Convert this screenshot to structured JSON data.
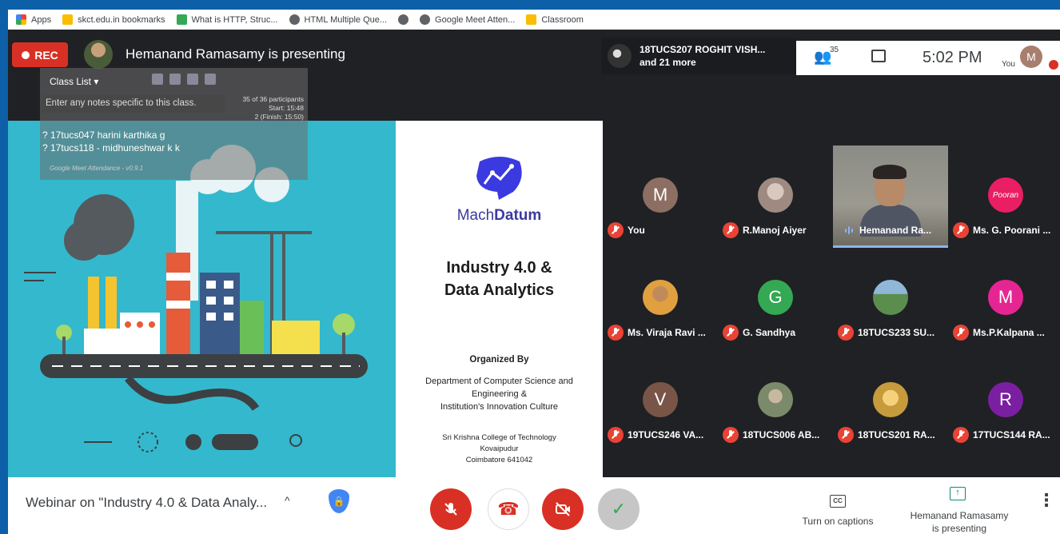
{
  "bookmarks": [
    {
      "label": "Apps",
      "icon": "apps-grid-icon",
      "color": "#ea4335"
    },
    {
      "label": "skct.edu.in bookmarks",
      "icon": "folder-icon",
      "color": "#fbbc04"
    },
    {
      "label": "What is HTTP, Struc...",
      "icon": "site-favicon",
      "color": "#34a853"
    },
    {
      "label": "HTML Multiple Que...",
      "icon": "globe-icon",
      "color": "#5f6368"
    },
    {
      "label": "",
      "icon": "globe-icon",
      "color": "#5f6368"
    },
    {
      "label": "Google Meet Atten...",
      "icon": "globe-icon",
      "color": "#5f6368"
    },
    {
      "label": "Classroom",
      "icon": "classroom-icon",
      "color": "#fbbc04"
    }
  ],
  "topbar": {
    "rec_label": "REC",
    "presenting_text": "Hemanand Ramasamy is presenting",
    "participants_line1": "18TUCS207 ROGHIT VISH...",
    "participants_line2": "and 21 more",
    "people_count": "35",
    "time": "5:02 PM",
    "you_label": "You",
    "avatar_letter": "M"
  },
  "class_list": {
    "title": "Class List ▾",
    "notes_placeholder": "Enter any notes specific to this class.",
    "stats_line1": "35 of 36 participants",
    "stats_line2": "Start: 15:48",
    "stats_line3": "2 (Finish: 15:50)",
    "names": [
      "? 17tucs047 harini karthika g",
      "? 17tucs118 - midhuneshwar k k"
    ],
    "footer": "Google Meet Attendance - v0.9.1"
  },
  "slide": {
    "logo_prefix": "Mach",
    "logo_suffix": "Datum",
    "title_line1": "Industry 4.0 &",
    "title_line2": "Data Analytics",
    "organized_by": "Organized By",
    "dept_line1": "Department of Computer Science and",
    "dept_line2": "Engineering &",
    "dept_line3": "Institution's Innovation Culture",
    "college_line1": "Sri Krishna College of Technology",
    "college_line2": "Kovaipudur",
    "college_line3": "Coimbatore 641042"
  },
  "tiles": [
    {
      "name": "You",
      "letter": "M",
      "color": "#8d6e63"
    },
    {
      "name": "R.Manoj Aiyer",
      "letter": "",
      "color": "#9e8a80"
    },
    {
      "name": "Hemanand Ra...",
      "letter": "",
      "color": "#8b8c86"
    },
    {
      "name": "Ms. G. Poorani ...",
      "letter": "Pooran",
      "color": "#e91e63"
    },
    {
      "name": "Ms. Viraja Ravi ...",
      "letter": "",
      "color": "#c9a06a"
    },
    {
      "name": "G. Sandhya",
      "letter": "G",
      "color": "#34a853"
    },
    {
      "name": "18TUCS233 SU...",
      "letter": "",
      "color": "#5b8e4e"
    },
    {
      "name": "Ms.P.Kalpana ...",
      "letter": "M",
      "color": "#e52592"
    },
    {
      "name": "19TUCS246 VA...",
      "letter": "V",
      "color": "#795548"
    },
    {
      "name": "18TUCS006 AB...",
      "letter": "",
      "color": "#7a8a6a"
    },
    {
      "name": "18TUCS201 RA...",
      "letter": "",
      "color": "#c79a3c"
    },
    {
      "name": "17TUCS144 RA...",
      "letter": "R",
      "color": "#7b1fa2"
    }
  ],
  "bottombar": {
    "meeting_title": "Webinar on \"Industry 4.0 & Data Analy...",
    "chevron": "^",
    "captions_label": "Turn on captions",
    "cc_glyph": "CC",
    "presenting_line1": "Hemanand Ramasamy",
    "presenting_line2": "is presenting",
    "present_glyph": "↑",
    "more_glyph": "⋮",
    "end_glyph": "☎",
    "check_glyph": "✓"
  }
}
